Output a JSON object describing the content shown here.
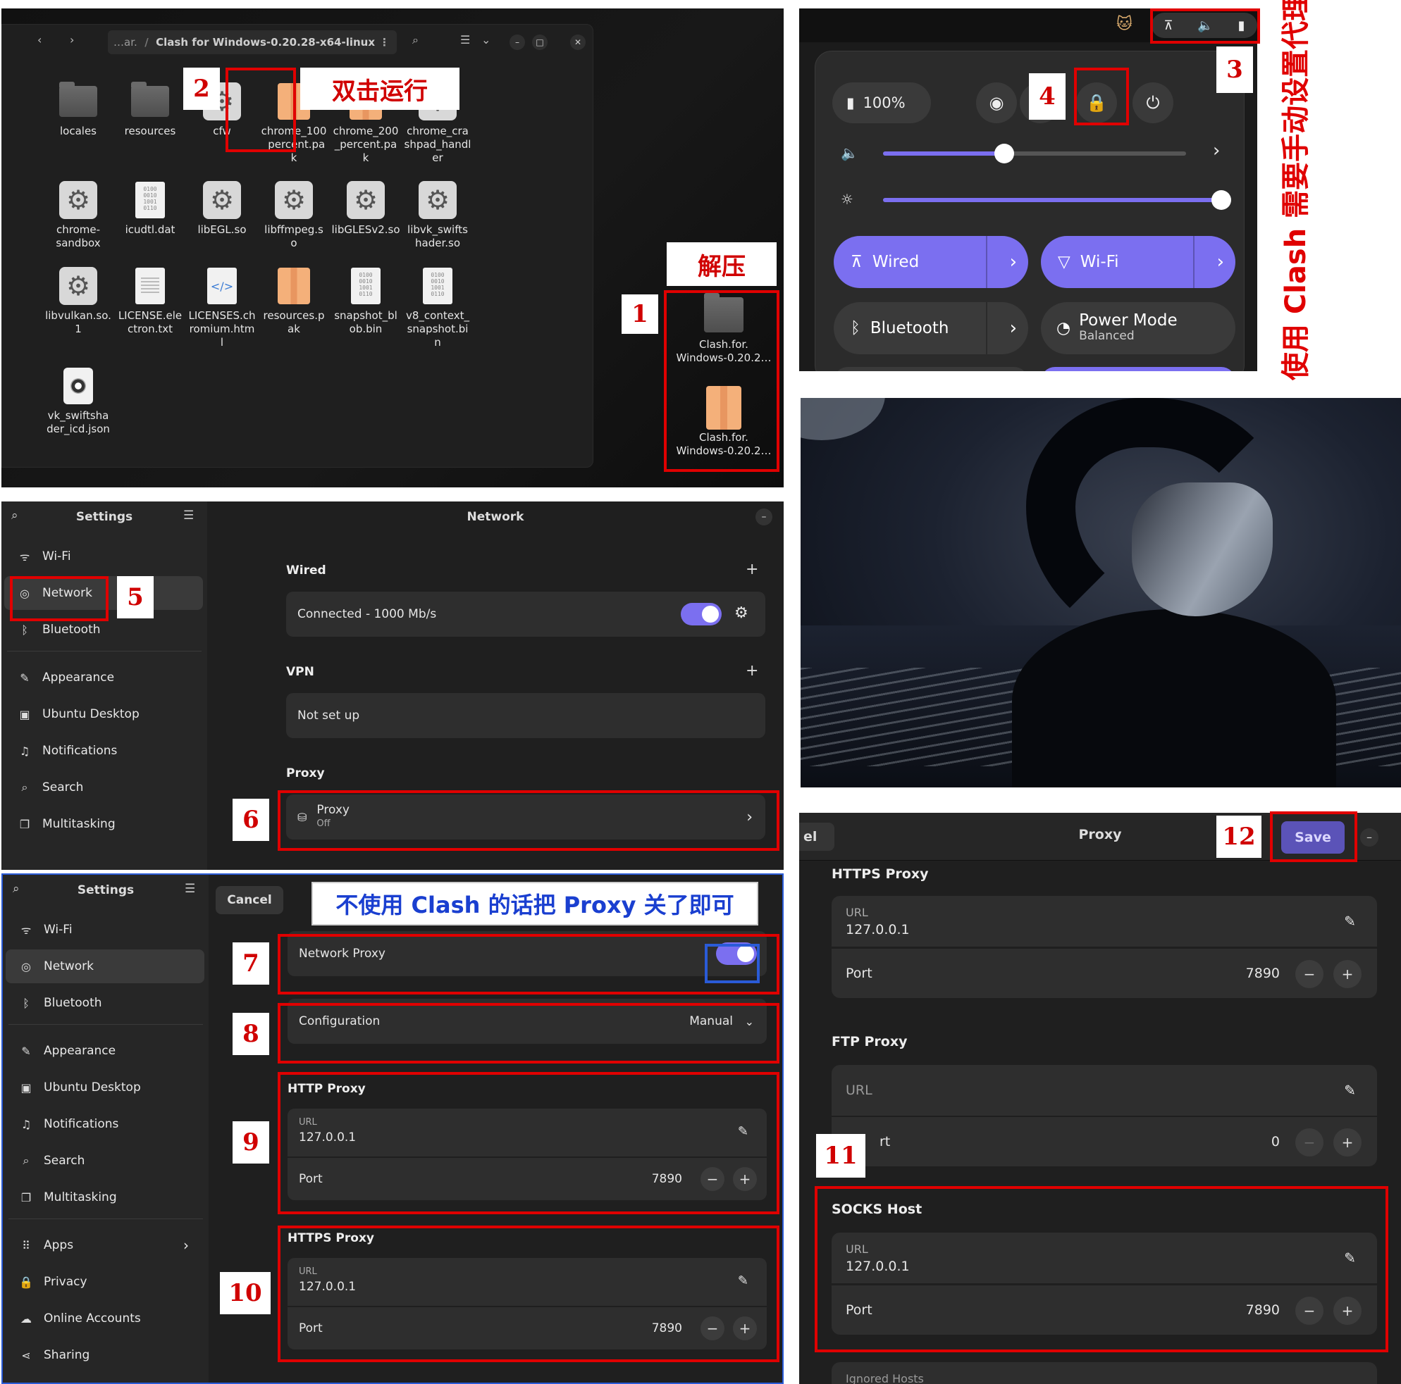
{
  "file_manager": {
    "path_prefix": "…ar.",
    "path_sep": "/",
    "path_current": "Clash for Windows-0.20.28-x64-linux",
    "files": [
      {
        "name": "locales",
        "icon": "folder-icon"
      },
      {
        "name": "resources",
        "icon": "folder-icon"
      },
      {
        "name": "cfw",
        "icon": "executable-gear-icon"
      },
      {
        "name": "chrome_100\n_percent.pa\nk",
        "icon": "package-icon"
      },
      {
        "name": "chrome_200\n_percent.pa\nk",
        "icon": "package-icon"
      },
      {
        "name": "chrome_cra\nshpad_handl\ner",
        "icon": "executable-gear-icon"
      },
      {
        "name": "chrome-\nsandbox",
        "icon": "executable-gear-icon"
      },
      {
        "name": "icudtl.dat",
        "icon": "binary-icon"
      },
      {
        "name": "libEGL.so",
        "icon": "executable-gear-icon"
      },
      {
        "name": "libffmpeg.s\no",
        "icon": "executable-gear-icon"
      },
      {
        "name": "libGLESv2.so",
        "icon": "executable-gear-icon"
      },
      {
        "name": "libvk_swifts\nhader.so",
        "icon": "executable-gear-icon"
      },
      {
        "name": "libvulkan.so.\n1",
        "icon": "executable-gear-icon"
      },
      {
        "name": "LICENSE.ele\nctron.txt",
        "icon": "text-icon"
      },
      {
        "name": "LICENSES.ch\nromium.htm\nl",
        "icon": "html-icon"
      },
      {
        "name": "resources.p\nak",
        "icon": "package-icon"
      },
      {
        "name": "snapshot_bl\nob.bin",
        "icon": "binary-icon"
      },
      {
        "name": "v8_context_\nsnapshot.bi\nn",
        "icon": "binary-icon"
      },
      {
        "name": "vk_swiftsha\nder_icd.json",
        "icon": "json-icon"
      }
    ],
    "desktop_items": [
      {
        "name": "Clash.for.\nWindows-0.20.2…",
        "icon": "folder-icon"
      },
      {
        "name": "Clash.for.\nWindows-0.20.2…",
        "icon": "archive-icon"
      }
    ],
    "binary_glyph": "0100\n0010\n1001\n0110"
  },
  "quick_settings": {
    "battery": "100%",
    "tiles": {
      "wired": "Wired",
      "wifi": "Wi-Fi",
      "bluetooth": "Bluetooth",
      "power_mode": "Power Mode",
      "power_mode_sub": "Balanced"
    },
    "volume_level": 0.4,
    "brightness_level": 1.0
  },
  "settings1": {
    "title": "Settings",
    "page_title": "Network",
    "sidebar": [
      "Wi-Fi",
      "Network",
      "Bluetooth",
      "Appearance",
      "Ubuntu Desktop",
      "Notifications",
      "Search",
      "Multitasking"
    ],
    "wired_header": "Wired",
    "wired_status": "Connected - 1000 Mb/s",
    "vpn_header": "VPN",
    "vpn_status": "Not set up",
    "proxy_header": "Proxy",
    "proxy_row": "Proxy",
    "proxy_row_sub": "Off"
  },
  "settings2": {
    "title": "Settings",
    "cancel": "Cancel",
    "sidebar": [
      "Wi-Fi",
      "Network",
      "Bluetooth",
      "Appearance",
      "Ubuntu Desktop",
      "Notifications",
      "Search",
      "Multitasking",
      "Apps",
      "Privacy",
      "Online Accounts",
      "Sharing"
    ],
    "network_proxy": "Network Proxy",
    "configuration": "Configuration",
    "configuration_value": "Manual",
    "http_header": "HTTP Proxy",
    "https_header": "HTTPS Proxy",
    "url_label": "URL",
    "url_value": "127.0.0.1",
    "port_label": "Port",
    "port_value": "7890"
  },
  "proxy_dialog": {
    "partial_left": "el",
    "title": "Proxy",
    "save": "Save",
    "https_header": "HTTPS Proxy",
    "ftp_header": "FTP Proxy",
    "socks_header": "SOCKS Host",
    "url_label": "URL",
    "port_label": "Port",
    "port_partial": "rt",
    "https_url": "127.0.0.1",
    "https_port": "7890",
    "ftp_url": "URL",
    "ftp_port": "0",
    "socks_url": "127.0.0.1",
    "socks_port": "7890",
    "ignored_hosts": "Ignored Hosts"
  },
  "annotations": {
    "n1": "1",
    "n2": "2",
    "n3": "3",
    "n4": "4",
    "n5": "5",
    "n6": "6",
    "n7": "7",
    "n8": "8",
    "n9": "9",
    "n10": "10",
    "n11": "11",
    "n12": "12",
    "double_click": "双击运行",
    "extract": "解压",
    "manual_proxy_note": "使用 Clash 需要手动设置代理",
    "disable_note": "不使用 Clash 的话把 Proxy 关了即可"
  },
  "colors": {
    "accent": "#7b6ff0",
    "annotation_red": "#e00000",
    "annotation_blue": "#2a5bd7"
  }
}
